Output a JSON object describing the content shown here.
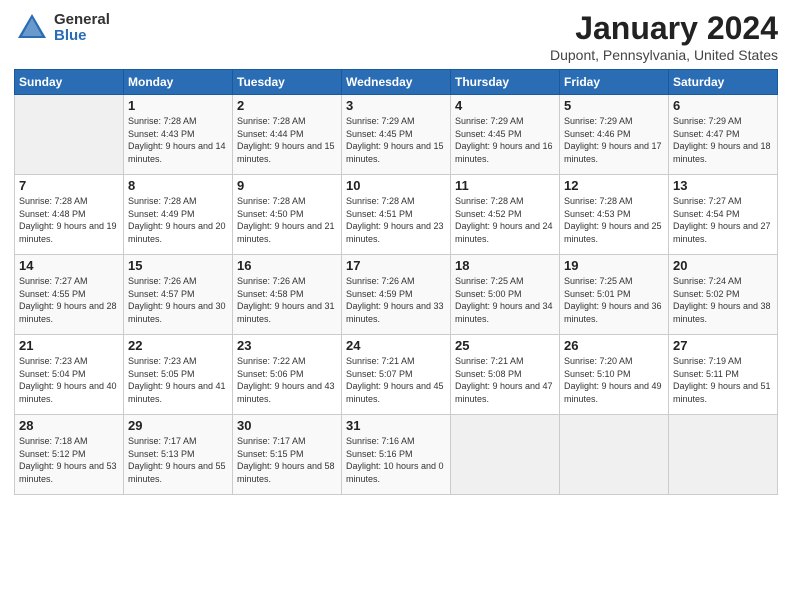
{
  "header": {
    "logo_general": "General",
    "logo_blue": "Blue",
    "title": "January 2024",
    "location": "Dupont, Pennsylvania, United States"
  },
  "weekdays": [
    "Sunday",
    "Monday",
    "Tuesday",
    "Wednesday",
    "Thursday",
    "Friday",
    "Saturday"
  ],
  "weeks": [
    [
      {
        "day": "",
        "sunrise": "",
        "sunset": "",
        "daylight": "",
        "empty": true
      },
      {
        "day": "1",
        "sunrise": "Sunrise: 7:28 AM",
        "sunset": "Sunset: 4:43 PM",
        "daylight": "Daylight: 9 hours and 14 minutes."
      },
      {
        "day": "2",
        "sunrise": "Sunrise: 7:28 AM",
        "sunset": "Sunset: 4:44 PM",
        "daylight": "Daylight: 9 hours and 15 minutes."
      },
      {
        "day": "3",
        "sunrise": "Sunrise: 7:29 AM",
        "sunset": "Sunset: 4:45 PM",
        "daylight": "Daylight: 9 hours and 15 minutes."
      },
      {
        "day": "4",
        "sunrise": "Sunrise: 7:29 AM",
        "sunset": "Sunset: 4:45 PM",
        "daylight": "Daylight: 9 hours and 16 minutes."
      },
      {
        "day": "5",
        "sunrise": "Sunrise: 7:29 AM",
        "sunset": "Sunset: 4:46 PM",
        "daylight": "Daylight: 9 hours and 17 minutes."
      },
      {
        "day": "6",
        "sunrise": "Sunrise: 7:29 AM",
        "sunset": "Sunset: 4:47 PM",
        "daylight": "Daylight: 9 hours and 18 minutes."
      }
    ],
    [
      {
        "day": "7",
        "sunrise": "Sunrise: 7:28 AM",
        "sunset": "Sunset: 4:48 PM",
        "daylight": "Daylight: 9 hours and 19 minutes."
      },
      {
        "day": "8",
        "sunrise": "Sunrise: 7:28 AM",
        "sunset": "Sunset: 4:49 PM",
        "daylight": "Daylight: 9 hours and 20 minutes."
      },
      {
        "day": "9",
        "sunrise": "Sunrise: 7:28 AM",
        "sunset": "Sunset: 4:50 PM",
        "daylight": "Daylight: 9 hours and 21 minutes."
      },
      {
        "day": "10",
        "sunrise": "Sunrise: 7:28 AM",
        "sunset": "Sunset: 4:51 PM",
        "daylight": "Daylight: 9 hours and 23 minutes."
      },
      {
        "day": "11",
        "sunrise": "Sunrise: 7:28 AM",
        "sunset": "Sunset: 4:52 PM",
        "daylight": "Daylight: 9 hours and 24 minutes."
      },
      {
        "day": "12",
        "sunrise": "Sunrise: 7:28 AM",
        "sunset": "Sunset: 4:53 PM",
        "daylight": "Daylight: 9 hours and 25 minutes."
      },
      {
        "day": "13",
        "sunrise": "Sunrise: 7:27 AM",
        "sunset": "Sunset: 4:54 PM",
        "daylight": "Daylight: 9 hours and 27 minutes."
      }
    ],
    [
      {
        "day": "14",
        "sunrise": "Sunrise: 7:27 AM",
        "sunset": "Sunset: 4:55 PM",
        "daylight": "Daylight: 9 hours and 28 minutes."
      },
      {
        "day": "15",
        "sunrise": "Sunrise: 7:26 AM",
        "sunset": "Sunset: 4:57 PM",
        "daylight": "Daylight: 9 hours and 30 minutes."
      },
      {
        "day": "16",
        "sunrise": "Sunrise: 7:26 AM",
        "sunset": "Sunset: 4:58 PM",
        "daylight": "Daylight: 9 hours and 31 minutes."
      },
      {
        "day": "17",
        "sunrise": "Sunrise: 7:26 AM",
        "sunset": "Sunset: 4:59 PM",
        "daylight": "Daylight: 9 hours and 33 minutes."
      },
      {
        "day": "18",
        "sunrise": "Sunrise: 7:25 AM",
        "sunset": "Sunset: 5:00 PM",
        "daylight": "Daylight: 9 hours and 34 minutes."
      },
      {
        "day": "19",
        "sunrise": "Sunrise: 7:25 AM",
        "sunset": "Sunset: 5:01 PM",
        "daylight": "Daylight: 9 hours and 36 minutes."
      },
      {
        "day": "20",
        "sunrise": "Sunrise: 7:24 AM",
        "sunset": "Sunset: 5:02 PM",
        "daylight": "Daylight: 9 hours and 38 minutes."
      }
    ],
    [
      {
        "day": "21",
        "sunrise": "Sunrise: 7:23 AM",
        "sunset": "Sunset: 5:04 PM",
        "daylight": "Daylight: 9 hours and 40 minutes."
      },
      {
        "day": "22",
        "sunrise": "Sunrise: 7:23 AM",
        "sunset": "Sunset: 5:05 PM",
        "daylight": "Daylight: 9 hours and 41 minutes."
      },
      {
        "day": "23",
        "sunrise": "Sunrise: 7:22 AM",
        "sunset": "Sunset: 5:06 PM",
        "daylight": "Daylight: 9 hours and 43 minutes."
      },
      {
        "day": "24",
        "sunrise": "Sunrise: 7:21 AM",
        "sunset": "Sunset: 5:07 PM",
        "daylight": "Daylight: 9 hours and 45 minutes."
      },
      {
        "day": "25",
        "sunrise": "Sunrise: 7:21 AM",
        "sunset": "Sunset: 5:08 PM",
        "daylight": "Daylight: 9 hours and 47 minutes."
      },
      {
        "day": "26",
        "sunrise": "Sunrise: 7:20 AM",
        "sunset": "Sunset: 5:10 PM",
        "daylight": "Daylight: 9 hours and 49 minutes."
      },
      {
        "day": "27",
        "sunrise": "Sunrise: 7:19 AM",
        "sunset": "Sunset: 5:11 PM",
        "daylight": "Daylight: 9 hours and 51 minutes."
      }
    ],
    [
      {
        "day": "28",
        "sunrise": "Sunrise: 7:18 AM",
        "sunset": "Sunset: 5:12 PM",
        "daylight": "Daylight: 9 hours and 53 minutes."
      },
      {
        "day": "29",
        "sunrise": "Sunrise: 7:17 AM",
        "sunset": "Sunset: 5:13 PM",
        "daylight": "Daylight: 9 hours and 55 minutes."
      },
      {
        "day": "30",
        "sunrise": "Sunrise: 7:17 AM",
        "sunset": "Sunset: 5:15 PM",
        "daylight": "Daylight: 9 hours and 58 minutes."
      },
      {
        "day": "31",
        "sunrise": "Sunrise: 7:16 AM",
        "sunset": "Sunset: 5:16 PM",
        "daylight": "Daylight: 10 hours and 0 minutes."
      },
      {
        "day": "",
        "sunrise": "",
        "sunset": "",
        "daylight": "",
        "empty": true
      },
      {
        "day": "",
        "sunrise": "",
        "sunset": "",
        "daylight": "",
        "empty": true
      },
      {
        "day": "",
        "sunrise": "",
        "sunset": "",
        "daylight": "",
        "empty": true
      }
    ]
  ]
}
